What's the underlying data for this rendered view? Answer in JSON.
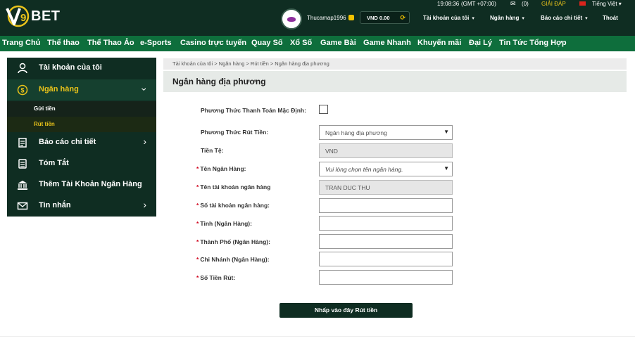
{
  "brand": {
    "logo_text": "BET",
    "logo_letter": "V9"
  },
  "topbar": {
    "time": "19:08:36",
    "timezone": "(GMT +07:00)",
    "mail_count": "(0)",
    "help": "GIẢI ĐÁP",
    "language": "Tiếng Việt"
  },
  "user": {
    "username": "Thucamap1996",
    "balance": "VND 0.00"
  },
  "header_menu": {
    "account": "Tài khoản của tôi",
    "bank": "Ngân hàng",
    "report": "Báo cáo chi tiết",
    "logout": "Thoát"
  },
  "nav": [
    "Trang Chủ",
    "Thể thao",
    "Thể Thao Ảo",
    "e-Sports",
    "Casino trực tuyến",
    "Quay Số",
    "Xổ Số",
    "Game Bài",
    "Game Nhanh",
    "Khuyến mãi",
    "Đại Lý",
    "Tin Tức Tổng Hợp"
  ],
  "sidebar": {
    "items": [
      {
        "label": "Tài khoản của tôi",
        "icon": "user-icon"
      },
      {
        "label": "Ngân hàng",
        "icon": "dollar-coin-icon"
      },
      {
        "label": "Báo cáo chi tiết",
        "icon": "report-icon"
      },
      {
        "label": "Tóm Tắt",
        "icon": "summary-icon"
      },
      {
        "label": "Thêm Tài Khoản Ngân Hàng",
        "icon": "bank-icon"
      },
      {
        "label": "Tin nhắn",
        "icon": "mail-icon"
      }
    ],
    "sub_items": [
      "Gửi tiền",
      "Rút tiền"
    ]
  },
  "breadcrumb": "Tài khoản của tôi > Ngân hàng > Rút tiền > Ngân hàng địa phương",
  "page_title": "Ngân hàng địa phương",
  "form": {
    "default_payment_label": "Phương Thức Thanh Toán Mặc Định:",
    "withdraw_method_label": "Phương Thức Rút Tiền:",
    "withdraw_method_value": "Ngân hàng địa phương",
    "currency_label": "Tiền Tệ:",
    "currency_value": "VND",
    "bank_name_label": "Tên Ngân Hàng:",
    "bank_name_placeholder": "Vui lòng chọn tên ngân hàng.",
    "account_name_label": "Tên tài khoản ngân hàng",
    "account_name_value": "TRAN DUC THU",
    "account_number_label": "Số tài khoản ngân hàng:",
    "province_label": "Tỉnh (Ngân Hàng):",
    "city_label": "Thành Phố (Ngân Hàng):",
    "branch_label": "Chi Nhánh (Ngân Hàng):",
    "amount_label": "Số Tiền Rút:",
    "submit_label": "Nhấp vào đây Rút tiền"
  },
  "colors": {
    "header_bg": "#0f2d22",
    "nav_bg": "#0e6e3c",
    "accent_gold": "#e8c21a",
    "required": "#d0021b"
  }
}
